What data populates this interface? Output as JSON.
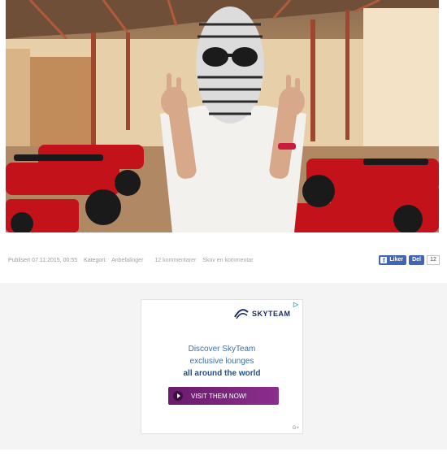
{
  "meta": {
    "published": "Publisert 07.11.2015, 00:55",
    "category_label": "Kategori:",
    "category": "Anbefalinger",
    "comments": "12 kommentarer",
    "write_comment": "Skriv en kommentar"
  },
  "facebook": {
    "like_label": "Liker",
    "share_label": "Del",
    "count": "12"
  },
  "ad": {
    "brand": "SKYTEAM",
    "line1": "Discover SkyTeam",
    "line2": "exclusive lounges",
    "line3": "all around the world",
    "cta": "VISIT THEM NOW!",
    "adchoices_glyph": "▷",
    "gplus_label": "G+"
  },
  "colors": {
    "facebook": "#4267b2",
    "cta": "#7a257c",
    "ad_text": "#3b6ea8"
  },
  "icons": {
    "facebook": "facebook-logo-icon",
    "play": "play-icon",
    "brand": "skyteam-logo-icon",
    "adchoices": "adchoices-icon"
  }
}
